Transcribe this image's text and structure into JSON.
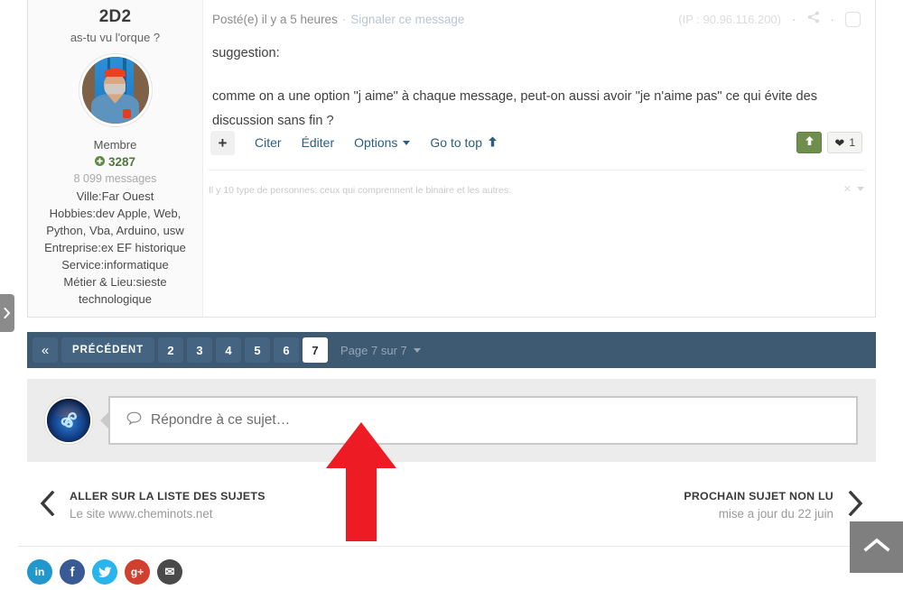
{
  "post": {
    "author": {
      "name": "2D2",
      "tagline": "as-tu vu l'orque ?",
      "avatar_alt": "member-photo-avatar",
      "rank": "Membre",
      "reputation": "3287",
      "reputation_icon": "circle-plus-icon",
      "message_count": "8 099 messages",
      "fields": [
        "Ville:Far Ouest",
        "Hobbies:dev Apple, Web, Python, Vba, Arduino, usw",
        "Entreprise:ex EF historique",
        "Service:informatique",
        "Métier & Lieu:sieste technologique"
      ]
    },
    "header": {
      "posted": "Posté(e) il y a 5 heures",
      "separator": "·",
      "report_link": "Signaler ce message",
      "ip": "(IP : 90.96.116.200)",
      "share_icon": "share-icon",
      "select_checkbox": "post-select-checkbox"
    },
    "body": [
      "suggestion:",
      "comme on a une option \"j aime\" à chaque message, peut-on aussi avoir \"je n'aime pas\" ce qui évite des discussion sans fin ?"
    ],
    "actions": {
      "multiquote": "+",
      "quote": "Citer",
      "edit": "Éditer",
      "options": "Options",
      "go_to_top": "Go to top",
      "upvote_icon": "arrow-up-icon",
      "like_icon": "heart-icon",
      "like_count": "1"
    },
    "signature": {
      "text": "Il y 10 type de personnes: ceux qui comprennent le binaire et les autres.",
      "close_icon": "close-icon"
    }
  },
  "pagination": {
    "first_label": "«",
    "prev_label": "PRÉCÉDENT",
    "pages": [
      "2",
      "3",
      "4",
      "5",
      "6"
    ],
    "active_page": "7",
    "info": "Page 7 sur 7"
  },
  "reply": {
    "avatar_alt": "current-user-avatar",
    "bubble_icon": "speech-bubble-icon",
    "placeholder": "Répondre à ce sujet…"
  },
  "bottom_nav": {
    "left": {
      "title": "ALLER SUR LA LISTE DES SUJETS",
      "subtitle": "Le site www.cheminots.net",
      "icon": "chevron-left-icon"
    },
    "right": {
      "title": "PROCHAIN SUJET NON LU",
      "subtitle": "mise a jour du 22 juin",
      "icon": "chevron-right-icon"
    }
  },
  "social": [
    {
      "name": "linkedin",
      "glyph": "in",
      "color": "#2197cd"
    },
    {
      "name": "facebook",
      "glyph": "f",
      "color": "#3a5a96"
    },
    {
      "name": "twitter",
      "glyph": "t",
      "color": "#2ab4ec"
    },
    {
      "name": "google-plus",
      "glyph": "g+",
      "color": "#d1402f"
    },
    {
      "name": "email",
      "glyph": "✉",
      "color": "#4a4a4a"
    }
  ],
  "scroll_top": {
    "icon": "chevron-up-icon"
  },
  "edge_tab": {
    "icon": "chevron-right-icon"
  },
  "annotation": {
    "arrow": "red-up-arrow",
    "color": "#ed1c24"
  }
}
